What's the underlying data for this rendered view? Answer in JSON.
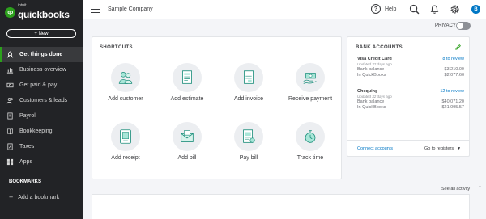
{
  "brand": {
    "intuit": "intuit",
    "name": "quickbooks",
    "badge": "qb"
  },
  "sidebar": {
    "new_label": "+ New",
    "items": [
      {
        "label": "Get things done",
        "active": true,
        "icon": "rocket-icon"
      },
      {
        "label": "Business overview",
        "icon": "chart-icon"
      },
      {
        "label": "Get paid & pay",
        "icon": "money-icon"
      },
      {
        "label": "Customers & leads",
        "icon": "people-icon"
      },
      {
        "label": "Payroll",
        "icon": "payroll-icon"
      },
      {
        "label": "Bookkeeping",
        "icon": "book-icon"
      },
      {
        "label": "Taxes",
        "icon": "taxes-icon"
      },
      {
        "label": "Apps",
        "icon": "apps-icon"
      }
    ],
    "bookmarks_title": "BOOKMARKS",
    "add_bookmark": "Add a bookmark"
  },
  "topbar": {
    "company": "Sample Company",
    "help_label": "Help",
    "avatar_letter": "B"
  },
  "privacy": {
    "label": "PRIVACY"
  },
  "shortcuts": {
    "title": "SHORTCUTS",
    "items": [
      {
        "label": "Add customer",
        "icon": "customer-icon"
      },
      {
        "label": "Add estimate",
        "icon": "estimate-icon"
      },
      {
        "label": "Add invoice",
        "icon": "invoice-icon"
      },
      {
        "label": "Receive payment",
        "icon": "payment-icon"
      },
      {
        "label": "Add receipt",
        "icon": "receipt-icon"
      },
      {
        "label": "Add bill",
        "icon": "bill-icon"
      },
      {
        "label": "Pay bill",
        "icon": "pay-bill-icon"
      },
      {
        "label": "Track time",
        "icon": "stopwatch-icon"
      }
    ]
  },
  "bank": {
    "title": "BANK ACCOUNTS",
    "accounts": [
      {
        "name": "Visa Credit Card",
        "review": "8 to review",
        "updated": "Updated 32 days ago",
        "bank_label": "Bank balance",
        "bank_value": "-$3,210.00",
        "qb_label": "In QuickBooks",
        "qb_value": "$2,077.60"
      },
      {
        "name": "Chequing",
        "review": "12 to review",
        "updated": "Updated 32 days ago",
        "bank_label": "Bank balance",
        "bank_value": "$40,071.20",
        "qb_label": "In QuickBooks",
        "qb_value": "$21,095.57"
      }
    ],
    "connect": "Connect accounts",
    "goto": "Go to registers"
  },
  "activity": {
    "see_all": "See all activity"
  },
  "colors": {
    "accent": "#2ca01c",
    "link": "#0077c5",
    "sidebar": "#222326"
  }
}
